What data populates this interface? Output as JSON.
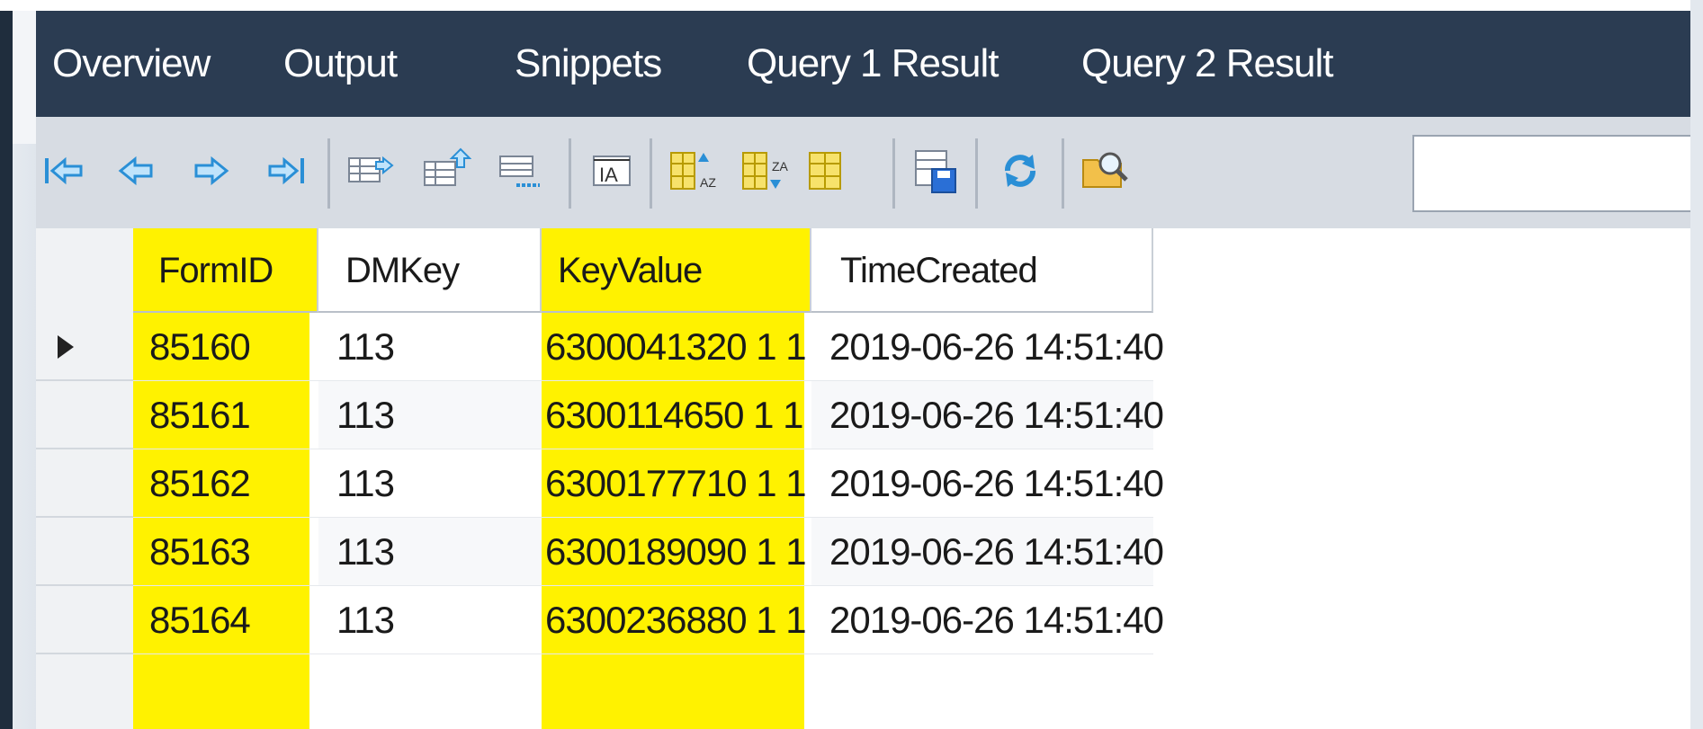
{
  "tabs": [
    "Overview",
    "Output",
    "Snippets",
    "Query 1 Result",
    "Query 2 Result"
  ],
  "toolbar": {
    "icons": [
      "first-record-icon",
      "previous-record-icon",
      "next-record-icon",
      "last-record-icon",
      "insert-row-icon",
      "append-row-icon",
      "delete-row-icon",
      "text-format-icon",
      "sort-ascending-icon",
      "sort-descending-icon",
      "columns-icon",
      "save-icon",
      "refresh-icon",
      "search-folder-icon"
    ],
    "search_value": ""
  },
  "grid": {
    "columns": [
      "FormID",
      "DMKey",
      "KeyValue",
      "TimeCreated"
    ],
    "highlighted_columns": [
      "FormID",
      "KeyValue"
    ],
    "highlight_color": "#fff200",
    "rows": [
      {
        "FormID": "85160",
        "DMKey": "113",
        "KeyValue": "6300041320 1 1",
        "TimeCreated": "2019-06-26 14:51:40"
      },
      {
        "FormID": "85161",
        "DMKey": "113",
        "KeyValue": "6300114650 1 1",
        "TimeCreated": "2019-06-26 14:51:40"
      },
      {
        "FormID": "85162",
        "DMKey": "113",
        "KeyValue": "6300177710 1 1",
        "TimeCreated": "2019-06-26 14:51:40"
      },
      {
        "FormID": "85163",
        "DMKey": "113",
        "KeyValue": "6300189090 1 1",
        "TimeCreated": "2019-06-26 14:51:40"
      },
      {
        "FormID": "85164",
        "DMKey": "113",
        "KeyValue": "6300236880 1 1",
        "TimeCreated": "2019-06-26 14:51:40"
      }
    ],
    "current_row": 0
  }
}
